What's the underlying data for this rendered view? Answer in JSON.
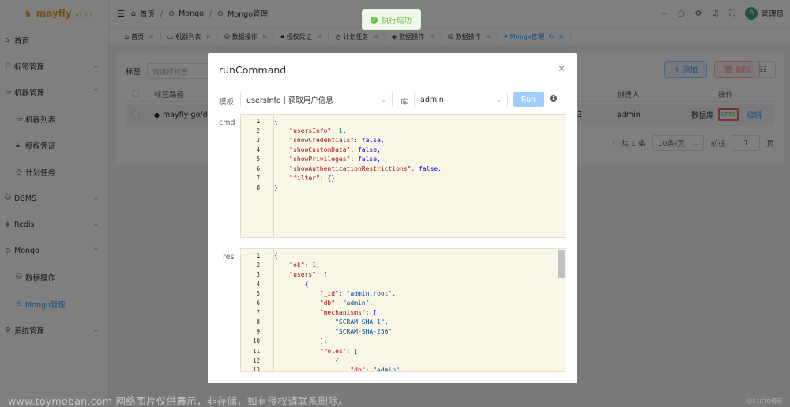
{
  "app": {
    "name": "mayfly",
    "version": "v1.5.1"
  },
  "sidebar": {
    "items": [
      {
        "label": "首页",
        "icon": "home-icon",
        "level": 0
      },
      {
        "label": "标签管理",
        "icon": "tag-icon",
        "level": 0,
        "expand": "⌄"
      },
      {
        "label": "机器管理",
        "icon": "monitor-icon",
        "level": 0,
        "expand": "⌃"
      },
      {
        "label": "机器列表",
        "icon": "monitor-icon",
        "level": 1
      },
      {
        "label": "授权凭证",
        "icon": "lock-icon",
        "level": 1
      },
      {
        "label": "计划任务",
        "icon": "timer-icon",
        "level": 1
      },
      {
        "label": "DBMS",
        "icon": "database-icon",
        "level": 0,
        "expand": "⌄"
      },
      {
        "label": "Redis",
        "icon": "redis-icon",
        "level": 0,
        "expand": "⌄"
      },
      {
        "label": "Mongo",
        "icon": "mongo-icon",
        "level": 0,
        "expand": "⌃"
      },
      {
        "label": "数据操作",
        "icon": "database-icon",
        "level": 1
      },
      {
        "label": "Mongo管理",
        "icon": "mongo-icon",
        "level": 1,
        "active": true
      },
      {
        "label": "系统管理",
        "icon": "gear-icon",
        "level": 0,
        "expand": "⌄"
      }
    ]
  },
  "header": {
    "breadcrumb": [
      "首页",
      "Mongo",
      "Mongo管理"
    ],
    "user": {
      "avatar_letter": "A",
      "name": "管理员"
    }
  },
  "tabs": [
    {
      "label": "首页"
    },
    {
      "label": "机器列表"
    },
    {
      "label": "数据操作"
    },
    {
      "label": "授权凭证"
    },
    {
      "label": "计划任务"
    },
    {
      "label": "数据操作"
    },
    {
      "label": "数据操作"
    },
    {
      "label": "Mongo管理",
      "active": true
    }
  ],
  "page": {
    "filter_label": "标签",
    "filter_placeholder": "请选择标签",
    "add_label": "添加",
    "delete_label": "删除",
    "columns": {
      "tag_path": "标签路径",
      "creator": "创建人",
      "actions": "操作"
    },
    "row": {
      "tag_path": "mayfly-go/de",
      "num_fragment": "3",
      "creator": "admin",
      "db_label": "数据库",
      "cmd_label": "cmd",
      "edit_label": "编辑"
    },
    "pager": {
      "total": "共 1 条",
      "page_size": "10条/页",
      "goto_label": "前往",
      "page": "1",
      "page_unit": "页"
    }
  },
  "toast": {
    "message": "执行成功"
  },
  "dialog": {
    "title": "runCommand",
    "template_label": "模板",
    "template_value": "usersInfo | 获取用户信息",
    "db_label": "库",
    "db_value": "admin",
    "run_label": "Run",
    "cmd_label": "cmd",
    "res_label": "res",
    "cmd_lines": [
      "{",
      "    \"usersInfo\": 1,",
      "    \"showCredentials\": false,",
      "    \"showCustomData\": false,",
      "    \"showPrivileges\": false,",
      "    \"showAuthenticationRestrictions\": false,",
      "    \"filter\": {}",
      "}"
    ],
    "res_lines": [
      "{",
      "    \"ok\": 1,",
      "    \"users\": [",
      "        {",
      "            \"_id\": \"admin.root\",",
      "            \"db\": \"admin\",",
      "            \"mechanisms\": [",
      "                \"SCRAM-SHA-1\",",
      "                \"SCRAM-SHA-256\"",
      "            ],",
      "            \"roles\": [",
      "                {",
      "                    \"db\": \"admin\","
    ]
  },
  "watermark": "www.toymoban.com 网络图片仅供展示，非存储，如有侵权请联系删除。",
  "watermark_small": "@51CTO博客"
}
